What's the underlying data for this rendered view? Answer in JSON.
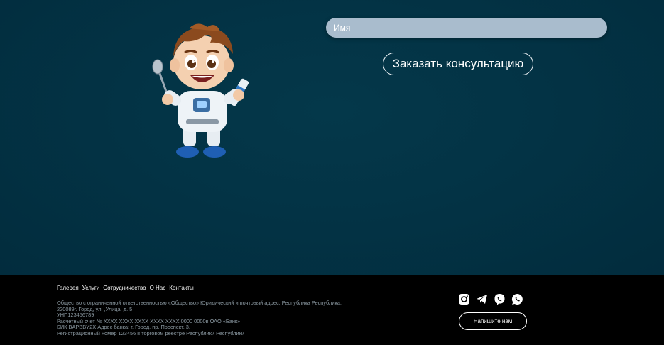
{
  "form": {
    "name_placeholder": "Имя",
    "submit_label": "Заказать консультацию"
  },
  "footer": {
    "nav": [
      "Галерея",
      "Услуги",
      "Сотрудничество",
      "О Нас",
      "Контакты"
    ],
    "legal": [
      "Общество с ограниченной ответственностью «Общество» Юридический и почтовый адрес: Республика Республика,",
      "220089г. Город, ул. ,Улица, д. 5",
      "УНП123456789",
      "Расчетный счет № XXXX XXXX XXXX XXXX XXXX 0000 0000в ОАО «Банк»",
      "БИК BAPBBY2X Адрес банка: г. Город, пр. Проспект, 3.",
      "Регистрационный номер 123456 в торговом реестре Республики Республики"
    ],
    "socials": [
      "instagram-icon",
      "telegram-icon",
      "viber-icon",
      "whatsapp-icon"
    ],
    "write_label": "Напишите нам"
  },
  "colors": {
    "background": "#033345",
    "footer": "#000000",
    "input": "#a9bccd"
  }
}
